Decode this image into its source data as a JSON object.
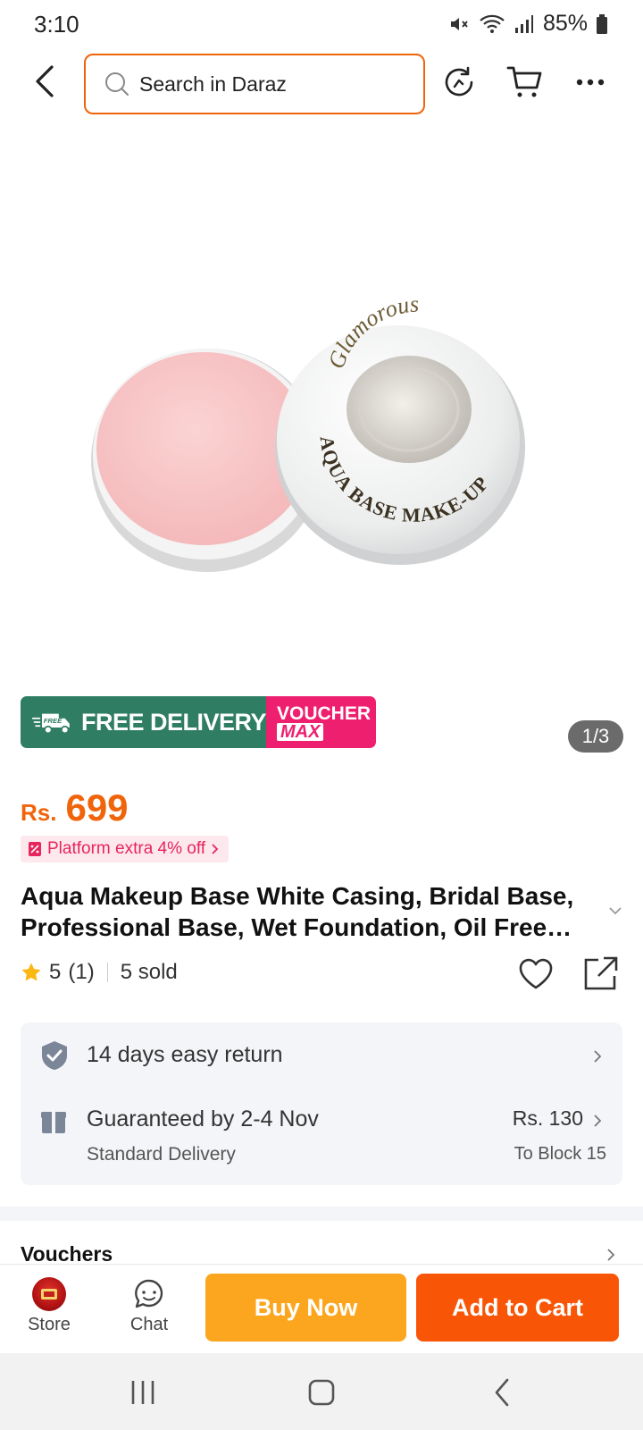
{
  "status_bar": {
    "time": "3:10",
    "battery": "85%"
  },
  "header": {
    "search_placeholder": "Search in Daraz",
    "icons": [
      "back-arrow-icon",
      "search-icon",
      "refresh-icon",
      "cart-icon",
      "more-icon"
    ]
  },
  "product": {
    "image_lid_text_brand": "Glamorous",
    "image_lid_text_product": "AQUA BASE MAKE-UP",
    "promo": {
      "free_badge": "FREE",
      "free_delivery": "FREE DELIVERY",
      "voucher": "VOUCHER",
      "voucher_max": "MAX"
    },
    "image_counter": "1/3",
    "price_currency": "Rs.",
    "price_amount": "699",
    "platform_tag": "Platform extra 4% off",
    "title": "Aqua Makeup Base White Casing, Bridal Base, Professional Base, Wet Foundation, Oil Free Foundation",
    "rating": "5",
    "rating_count": "(1)",
    "sold": "5 sold"
  },
  "services": {
    "return": {
      "label": "14 days easy return"
    },
    "delivery": {
      "label": "Guaranteed by 2-4 Nov",
      "sub": "Standard Delivery",
      "price": "Rs. 130",
      "destination": "To Block 15"
    }
  },
  "vouchers": {
    "label": "Vouchers"
  },
  "action_bar": {
    "store_label": "Store",
    "chat_label": "Chat",
    "buy_now": "Buy Now",
    "add_to_cart": "Add to Cart"
  },
  "colors": {
    "accent_orange": "#f85606",
    "buy_now_yellow": "#fca61f",
    "free_delivery_green": "#2f7d63",
    "voucher_pink": "#ee1f6f"
  }
}
